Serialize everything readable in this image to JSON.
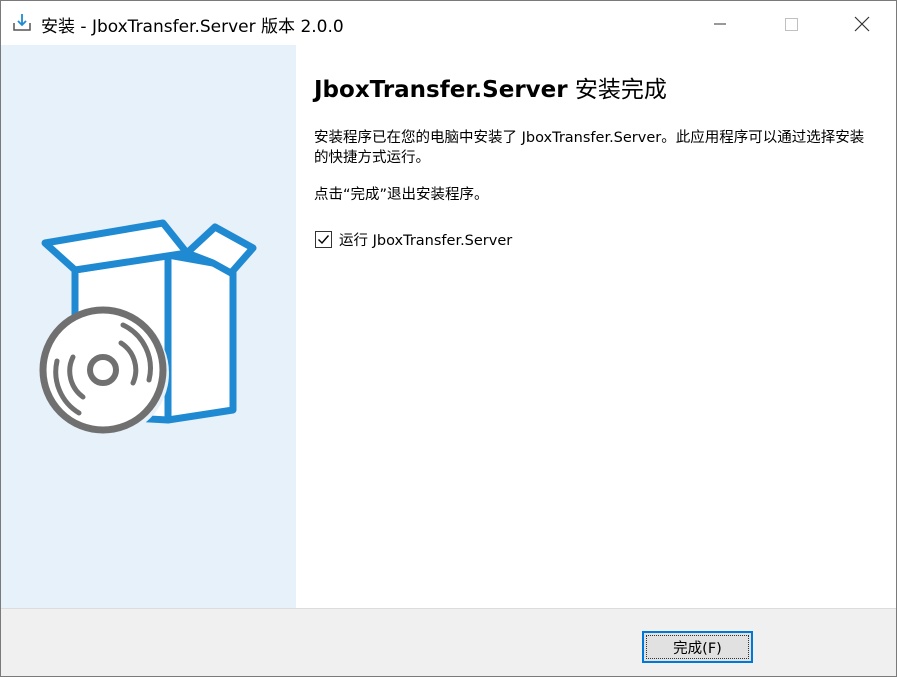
{
  "window": {
    "title": "安装 - JboxTransfer.Server 版本 2.0.0",
    "icon": "installer-download-icon"
  },
  "controls": {
    "minimize_icon": "minimize-icon",
    "maximize_icon": "maximize-icon",
    "close_icon": "close-icon"
  },
  "illustration": {
    "icon": "software-box-disc-icon",
    "colors": {
      "box": "#1f8ad2",
      "disc": "#707070",
      "panel": "#e6f1fa"
    }
  },
  "content": {
    "heading_product": "JboxTransfer.Server",
    "heading_suffix": " 安装完成",
    "paragraph1": "安装程序已在您的电脑中安装了 JboxTransfer.Server。此应用程序可以通过选择安装的快捷方式运行。",
    "paragraph2": "点击“完成”退出安装程序。",
    "run_checkbox": {
      "label": "运行 JboxTransfer.Server",
      "checked": true
    }
  },
  "footer": {
    "finish_label": "完成(F)",
    "accent": "#0078d7"
  }
}
